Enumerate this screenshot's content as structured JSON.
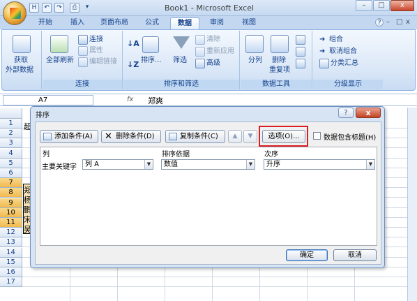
{
  "window": {
    "title": "Book1 - Microsoft Excel",
    "minimize": "–",
    "restore": "□",
    "close": "x",
    "doc_min": "–",
    "doc_restore": "□",
    "doc_close": "x",
    "help": "?"
  },
  "qat": {
    "save": "H",
    "undo": "↶",
    "redo": "↷",
    "print": "⎙",
    "more": "▾"
  },
  "tabs": [
    "开始",
    "插入",
    "页面布局",
    "公式",
    "数据",
    "审阅",
    "视图"
  ],
  "active_tab": "数据",
  "ribbon": {
    "groups": {
      "external": {
        "label1": "获取",
        "label2": "外部数据"
      },
      "connections": {
        "label": "连接",
        "refresh_all": "全部刷新",
        "connections": "连接",
        "properties": "属性",
        "edit_links": "编辑链接"
      },
      "sort_filter": {
        "label": "排序和筛选",
        "sort": "排序...",
        "filter": "筛选",
        "clear": "清除",
        "reapply": "重新应用",
        "advanced": "高级"
      },
      "data_tools": {
        "label": "数据工具",
        "text_to_columns": "分列",
        "remove_dup_1": "删除",
        "remove_dup_2": "重复项"
      },
      "outline": {
        "label": "分级显示",
        "group": "组合",
        "ungroup": "取消组合",
        "subtotal": "分类汇总"
      }
    }
  },
  "formula_bar": {
    "name_box": "A7",
    "fx": "fx",
    "content": "郑爽"
  },
  "grid": {
    "rows": [
      "1",
      "2",
      "3",
      "4",
      "5",
      "6",
      "7",
      "8",
      "9",
      "10",
      "11",
      "12",
      "13",
      "14",
      "15",
      "16",
      "17"
    ],
    "selected_rows": [
      "7",
      "8",
      "9",
      "10",
      "11"
    ],
    "visible_cell_fragments": {
      "1": "超",
      "7": "郑",
      "8": "杨",
      "9": "鹏",
      "10": "宋",
      "11": "吴"
    }
  },
  "sort_dialog": {
    "title": "排序",
    "buttons": {
      "add_level": "添加条件(A)",
      "delete_level": "删除条件(D)",
      "copy_level": "复制条件(C)",
      "move_up": "▲",
      "move_down": "▼",
      "options": "选项(O)...",
      "ok": "确定",
      "cancel": "取消"
    },
    "has_headers_label": "数据包含标题(H)",
    "has_headers_checked": false,
    "columns": {
      "column": "列",
      "sort_on": "排序依据",
      "order": "次序"
    },
    "rows": [
      {
        "label": "主要关键字",
        "column": "列 A",
        "sort_on": "数值",
        "order": "升序"
      }
    ]
  }
}
